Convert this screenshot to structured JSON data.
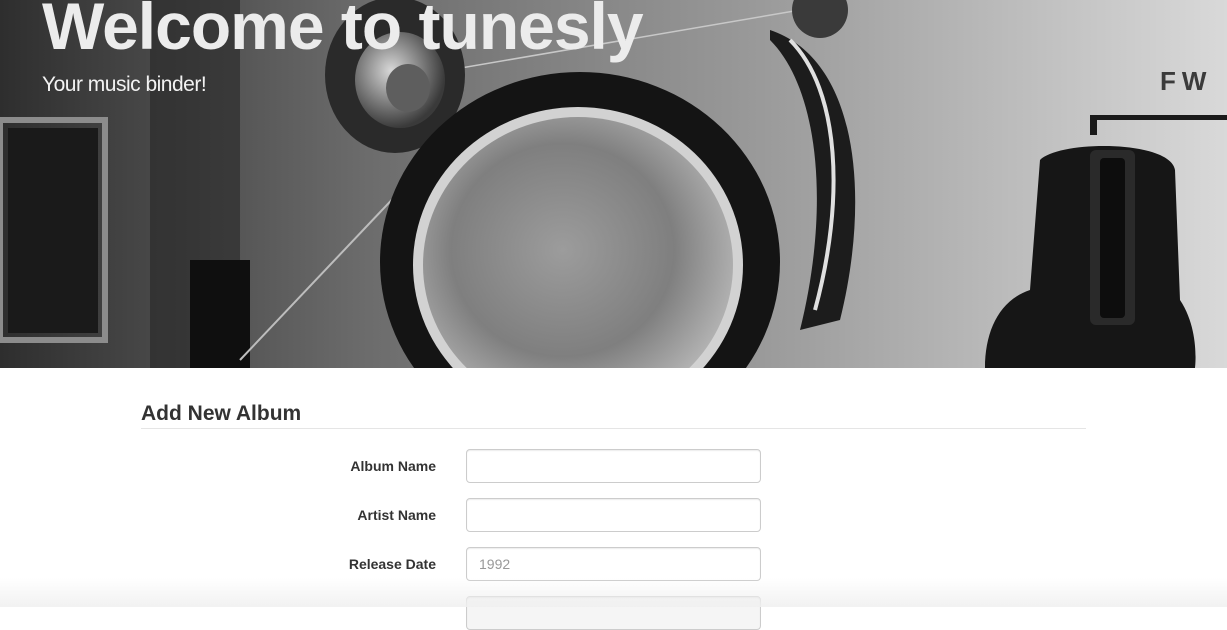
{
  "hero": {
    "title": "Welcome to tunesly",
    "subtitle": "Your music binder!",
    "device_label": "FW"
  },
  "form": {
    "heading": "Add New Album",
    "fields": [
      {
        "label": "Album Name",
        "value": "",
        "placeholder": ""
      },
      {
        "label": "Artist Name",
        "value": "",
        "placeholder": ""
      },
      {
        "label": "Release Date",
        "value": "",
        "placeholder": "1992"
      },
      {
        "label": "",
        "value": "",
        "placeholder": ""
      }
    ]
  },
  "colors": {
    "text": "#333333",
    "input_border": "#cccccc",
    "placeholder": "#999999",
    "rule": "#e5e5e5"
  }
}
